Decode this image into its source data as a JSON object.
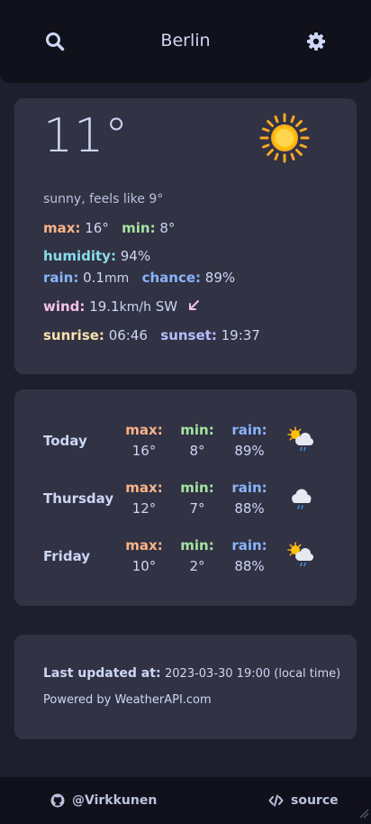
{
  "header": {
    "title": "Berlin"
  },
  "current": {
    "temperature": "11°",
    "condition": "sunny, feels like 9°",
    "max_label": "max:",
    "max_value": "16°",
    "min_label": "min:",
    "min_value": "8°",
    "humidity_label": "humidity:",
    "humidity_value": "94%",
    "rain_label": "rain:",
    "rain_value": "0.1",
    "rain_unit": "mm",
    "chance_label": "chance:",
    "chance_value": "89%",
    "wind_label": "wind:",
    "wind_value": "19.1",
    "wind_unit": "km/h",
    "wind_dir": "SW",
    "sunrise_label": "sunrise:",
    "sunrise_value": "06:46",
    "sunset_label": "sunset:",
    "sunset_value": "19:37",
    "icon": "sun-icon"
  },
  "forecast": {
    "max_label": "max:",
    "min_label": "min:",
    "rain_label": "rain:",
    "days": [
      {
        "name": "Today",
        "max": "16°",
        "min": "8°",
        "rain": "89%",
        "icon": "sun-cloud-rain-icon"
      },
      {
        "name": "Thursday",
        "max": "12°",
        "min": "7°",
        "rain": "88%",
        "icon": "cloud-rain-icon"
      },
      {
        "name": "Friday",
        "max": "10°",
        "min": "2°",
        "rain": "88%",
        "icon": "sun-cloud-rain-icon"
      }
    ]
  },
  "info": {
    "updated_label": "Last updated at:",
    "updated_value": "2023-03-30 19:00 (local time)",
    "powered_by": "Powered by WeatherAPI.com"
  },
  "footer": {
    "author": "@Virkkunen",
    "source": "source"
  },
  "colors": {
    "background": "#1e1e2e",
    "card": "#313244",
    "header": "#11111b",
    "max": "#fab387",
    "min": "#a6e3a1",
    "rain": "#89b4fa",
    "humidity": "#89dceb",
    "wind": "#f5c2e7",
    "sunrise": "#f9e2af",
    "sunset": "#b4befe"
  }
}
